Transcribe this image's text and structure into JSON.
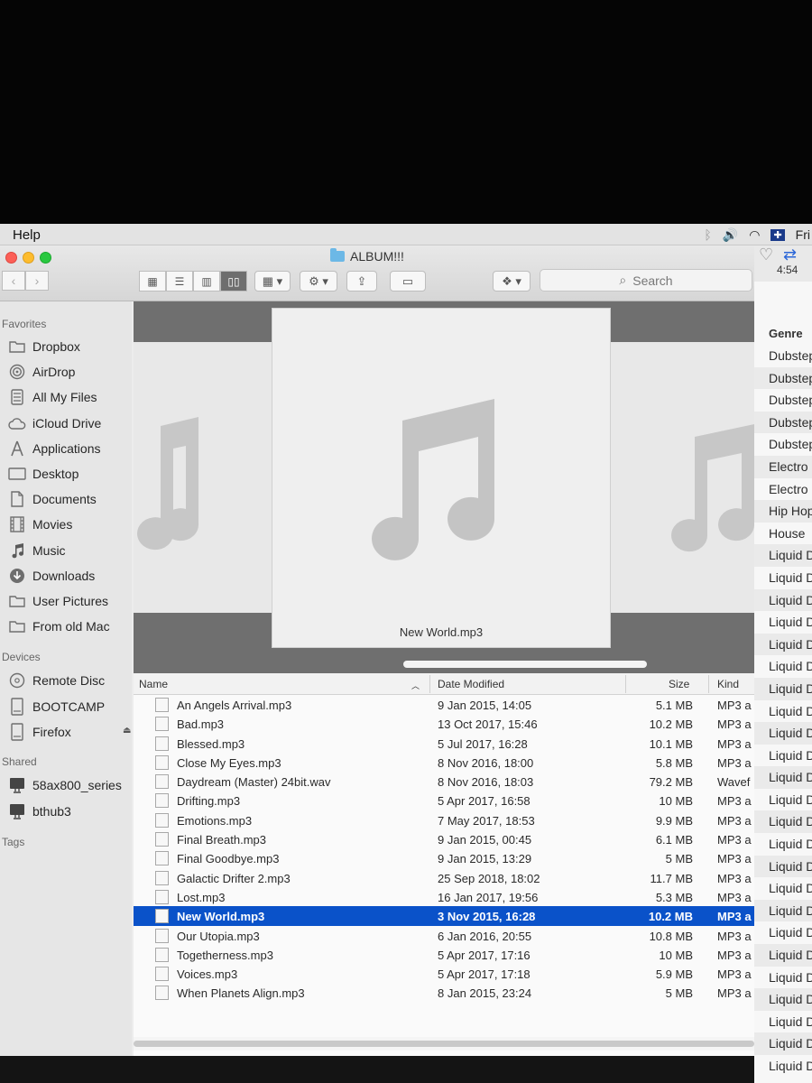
{
  "menubar": {
    "help": "Help",
    "clock": "Fri"
  },
  "window": {
    "title": "ALBUM!!!",
    "search_placeholder": "Search",
    "nav": {
      "back": "‹",
      "forward": "›"
    }
  },
  "sidebar": {
    "favorites_header": "Favorites",
    "favorites": [
      {
        "label": "Dropbox",
        "icon": "folder-icon"
      },
      {
        "label": "AirDrop",
        "icon": "airdrop-icon"
      },
      {
        "label": "All My Files",
        "icon": "all-files-icon"
      },
      {
        "label": "iCloud Drive",
        "icon": "cloud-icon"
      },
      {
        "label": "Applications",
        "icon": "applications-icon"
      },
      {
        "label": "Desktop",
        "icon": "desktop-icon"
      },
      {
        "label": "Documents",
        "icon": "document-icon"
      },
      {
        "label": "Movies",
        "icon": "movie-icon"
      },
      {
        "label": "Music",
        "icon": "music-icon"
      },
      {
        "label": "Downloads",
        "icon": "download-icon"
      },
      {
        "label": "User Pictures",
        "icon": "folder-icon"
      },
      {
        "label": "From old Mac",
        "icon": "folder-icon"
      }
    ],
    "devices_header": "Devices",
    "devices": [
      {
        "label": "Remote Disc",
        "icon": "disc-icon"
      },
      {
        "label": "BOOTCAMP",
        "icon": "drive-icon"
      },
      {
        "label": "Firefox",
        "icon": "drive-icon"
      }
    ],
    "shared_header": "Shared",
    "shared": [
      {
        "label": "58ax800_series",
        "icon": "monitor-icon"
      },
      {
        "label": "bthub3",
        "icon": "monitor-icon"
      }
    ],
    "tags_header": "Tags"
  },
  "preview": {
    "label": "New World.mp3"
  },
  "list": {
    "headers": {
      "name": "Name",
      "date": "Date Modified",
      "size": "Size",
      "kind": "Kind"
    },
    "rows": [
      {
        "name": "An Angels Arrival.mp3",
        "date": "9 Jan 2015, 14:05",
        "size": "5.1 MB",
        "kind": "MP3 a"
      },
      {
        "name": "Bad.mp3",
        "date": "13 Oct 2017, 15:46",
        "size": "10.2 MB",
        "kind": "MP3 a"
      },
      {
        "name": "Blessed.mp3",
        "date": "5 Jul 2017, 16:28",
        "size": "10.1 MB",
        "kind": "MP3 a"
      },
      {
        "name": "Close My Eyes.mp3",
        "date": "8 Nov 2016, 18:00",
        "size": "5.8 MB",
        "kind": "MP3 a"
      },
      {
        "name": "Daydream (Master) 24bit.wav",
        "date": "8 Nov 2016, 18:03",
        "size": "79.2 MB",
        "kind": "Wavef"
      },
      {
        "name": "Drifting.mp3",
        "date": "5 Apr 2017, 16:58",
        "size": "10 MB",
        "kind": "MP3 a"
      },
      {
        "name": "Emotions.mp3",
        "date": "7 May 2017, 18:53",
        "size": "9.9 MB",
        "kind": "MP3 a"
      },
      {
        "name": "Final Breath.mp3",
        "date": "9 Jan 2015, 00:45",
        "size": "6.1 MB",
        "kind": "MP3 a"
      },
      {
        "name": "Final Goodbye.mp3",
        "date": "9 Jan 2015, 13:29",
        "size": "5 MB",
        "kind": "MP3 a"
      },
      {
        "name": "Galactic Drifter 2.mp3",
        "date": "25 Sep 2018, 18:02",
        "size": "11.7 MB",
        "kind": "MP3 a"
      },
      {
        "name": "Lost.mp3",
        "date": "16 Jan 2017, 19:56",
        "size": "5.3 MB",
        "kind": "MP3 a"
      },
      {
        "name": "New World.mp3",
        "date": "3 Nov 2015, 16:28",
        "size": "10.2 MB",
        "kind": "MP3 a",
        "selected": true
      },
      {
        "name": "Our Utopia.mp3",
        "date": "6 Jan 2016, 20:55",
        "size": "10.8 MB",
        "kind": "MP3 a"
      },
      {
        "name": "Togetherness.mp3",
        "date": "5 Apr 2017, 17:16",
        "size": "10 MB",
        "kind": "MP3 a"
      },
      {
        "name": "Voices.mp3",
        "date": "5 Apr 2017, 17:18",
        "size": "5.9 MB",
        "kind": "MP3 a"
      },
      {
        "name": "When Planets Align.mp3",
        "date": "8 Jan 2015, 23:24",
        "size": "5 MB",
        "kind": "MP3 a"
      }
    ]
  },
  "right_pane": {
    "time": "4:54",
    "genre_header": "Genre",
    "genres": [
      "Dubstep",
      "Dubstep",
      "Dubstep",
      "Dubstep",
      "Dubstep",
      "Electro",
      "Electro",
      "Hip Hop",
      "House",
      "Liquid D",
      "Liquid D",
      "Liquid D",
      "Liquid D",
      "Liquid D",
      "Liquid D",
      "Liquid D",
      "Liquid D",
      "Liquid D",
      "Liquid D",
      "Liquid D",
      "Liquid D",
      "Liquid D",
      "Liquid D",
      "Liquid D",
      "Liquid D",
      "Liquid D",
      "Liquid D",
      "Liquid D",
      "Liquid D",
      "Liquid D",
      "Liquid D",
      "Liquid D",
      "Liquid D"
    ]
  },
  "colors": {
    "selection": "#0a52c9",
    "folder": "#6cb8e6"
  }
}
